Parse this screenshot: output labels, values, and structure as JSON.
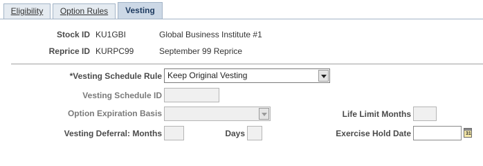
{
  "tabs": [
    {
      "label": "Eligibility"
    },
    {
      "label": "Option Rules"
    },
    {
      "label": "Vesting"
    }
  ],
  "header": {
    "stock_id_label": "Stock ID",
    "stock_id_value": "KU1GBI",
    "stock_id_desc": "Global Business Institute #1",
    "reprice_id_label": "Reprice ID",
    "reprice_id_value": "KURPC99",
    "reprice_id_desc": "September 99 Reprice"
  },
  "form": {
    "vesting_schedule_rule_label": "*Vesting Schedule Rule",
    "vesting_schedule_rule_value": "Keep Original Vesting",
    "vesting_schedule_id_label": "Vesting Schedule ID",
    "vesting_schedule_id_value": "",
    "option_expiration_basis_label": "Option Expiration Basis",
    "option_expiration_basis_value": "",
    "life_limit_months_label": "Life Limit Months",
    "life_limit_months_value": "",
    "vesting_deferral_months_label": "Vesting Deferral: Months",
    "vesting_deferral_months_value": "",
    "days_label": "Days",
    "days_value": "",
    "exercise_hold_date_label": "Exercise Hold Date",
    "exercise_hold_date_value": "",
    "calendar_icon_text": "31"
  }
}
